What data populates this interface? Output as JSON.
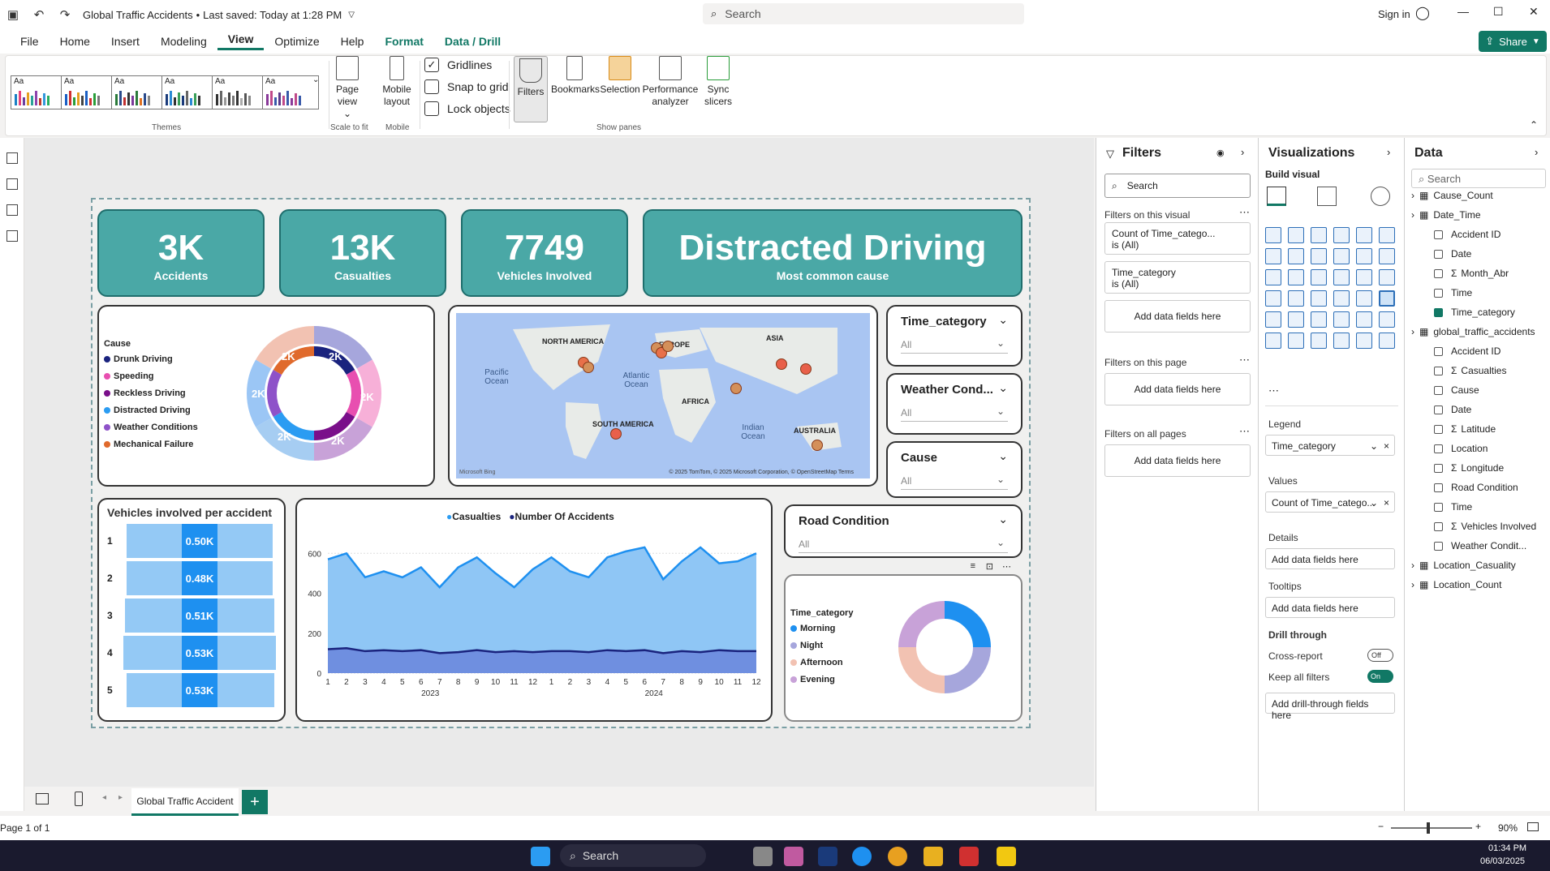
{
  "titlebar": {
    "title": "Global Traffic Accidents",
    "saved": "Last saved: Today at 1:28 PM",
    "search_placeholder": "Search",
    "signin": "Sign in"
  },
  "menu": [
    "File",
    "Home",
    "Insert",
    "Modeling",
    "View",
    "Optimize",
    "Help",
    "Format",
    "Data / Drill"
  ],
  "share": "Share",
  "ribbon": {
    "themes_label": "Themes",
    "page_view": "Page view",
    "scale_to_fit": "Scale to fit",
    "mobile_layout": "Mobile layout",
    "mobile": "Mobile",
    "gridlines": "Gridlines",
    "snap": "Snap to grid",
    "lock": "Lock objects",
    "filters": "Filters",
    "bookmarks": "Bookmarks",
    "selection": "Selection",
    "perf": "Performance analyzer",
    "sync": "Sync slicers",
    "show_panes": "Show panes"
  },
  "kpis": [
    {
      "value": "3K",
      "label": "Accidents"
    },
    {
      "value": "13K",
      "label": "Casualties"
    },
    {
      "value": "7749",
      "label": "Vehicles Involved"
    },
    {
      "value": "Distracted Driving",
      "label": "Most common cause"
    }
  ],
  "cause_donut": {
    "legend_title": "Cause",
    "items": [
      {
        "name": "Drunk Driving",
        "color": "#1a237e"
      },
      {
        "name": "Speeding",
        "color": "#e84fb0"
      },
      {
        "name": "Reckless Driving",
        "color": "#7a0f8a"
      },
      {
        "name": "Distracted Driving",
        "color": "#2b9cf2"
      },
      {
        "name": "Weather Conditions",
        "color": "#8e52c9"
      },
      {
        "name": "Mechanical Failure",
        "color": "#e06a2c"
      }
    ],
    "label": "2K"
  },
  "map": {
    "labels": [
      "NORTH AMERICA",
      "EUROPE",
      "ASIA",
      "AFRICA",
      "SOUTH AMERICA",
      "AUSTRALIA",
      "Pacific Ocean",
      "Atlantic Ocean",
      "Indian Ocean"
    ],
    "credit": "© 2025 TomTom, © 2025 Microsoft Corporation, © OpenStreetMap  Terms",
    "brand": "Microsoft Bing"
  },
  "slicers": [
    {
      "title": "Time_category",
      "value": "All"
    },
    {
      "title": "Weather Cond...",
      "value": "All"
    },
    {
      "title": "Cause",
      "value": "All"
    },
    {
      "title": "Road Condition",
      "value": "All"
    }
  ],
  "vehicles": {
    "title": "Vehicles involved per accident",
    "rows": [
      {
        "label": "1",
        "value": "0.50K"
      },
      {
        "label": "2",
        "value": "0.48K"
      },
      {
        "label": "3",
        "value": "0.51K"
      },
      {
        "label": "4",
        "value": "0.53K"
      },
      {
        "label": "5",
        "value": "0.53K"
      }
    ]
  },
  "chart_data": {
    "type": "area",
    "series": [
      {
        "name": "Casualties",
        "values": [
          570,
          600,
          480,
          510,
          480,
          530,
          430,
          530,
          580,
          500,
          430,
          520,
          580,
          510,
          480,
          580,
          610,
          630,
          470,
          560,
          630,
          550,
          560,
          600
        ]
      },
      {
        "name": "Number Of Accidents",
        "values": [
          120,
          125,
          110,
          115,
          110,
          115,
          100,
          105,
          115,
          105,
          110,
          105,
          110,
          110,
          105,
          115,
          110,
          115,
          100,
          110,
          105,
          115,
          110,
          110
        ]
      }
    ],
    "x": [
      "1",
      "2",
      "3",
      "4",
      "5",
      "6",
      "7",
      "8",
      "9",
      "10",
      "11",
      "12",
      "1",
      "2",
      "3",
      "4",
      "5",
      "6",
      "7",
      "8",
      "9",
      "10",
      "11",
      "12"
    ],
    "x_groups": [
      "2023",
      "2024"
    ],
    "yticks": [
      "0",
      "200",
      "400",
      "600"
    ],
    "ylim": [
      0,
      650
    ]
  },
  "time_donut": {
    "legend_title": "Time_category",
    "items": [
      {
        "name": "Morning",
        "color": "#1e90f0",
        "share": 25
      },
      {
        "name": "Night",
        "color": "#a6a6dc",
        "share": 25
      },
      {
        "name": "Afternoon",
        "color": "#f2c2b2",
        "share": 25
      },
      {
        "name": "Evening",
        "color": "#c8a2d8",
        "share": 25
      }
    ]
  },
  "filters_pane": {
    "title": "Filters",
    "search": "Search",
    "on_visual": "Filters on this visual",
    "f1": "Count of Time_catego...",
    "f1v": "is (All)",
    "f2": "Time_category",
    "f2v": "is (All)",
    "add": "Add data fields here",
    "on_page": "Filters on this page",
    "on_all": "Filters on all pages"
  },
  "viz_pane": {
    "title": "Visualizations",
    "build": "Build visual",
    "legend": "Legend",
    "legend_val": "Time_category",
    "values": "Values",
    "values_val": "Count of Time_catego...",
    "details": "Details",
    "tooltips": "Tooltips",
    "add": "Add data fields here",
    "drill": "Drill through",
    "cross": "Cross-report",
    "cross_state": "Off",
    "keep": "Keep all filters",
    "keep_state": "On",
    "add_drill": "Add drill-through fields here"
  },
  "data_pane": {
    "title": "Data",
    "search": "Search",
    "items": [
      {
        "label": "Cause_Count",
        "level": 0,
        "kind": "table"
      },
      {
        "label": "Date_Time",
        "level": 0,
        "kind": "table"
      },
      {
        "label": "Accident ID",
        "level": 1,
        "kind": "field"
      },
      {
        "label": "Date",
        "level": 1,
        "kind": "field"
      },
      {
        "label": "Month_Abr",
        "level": 1,
        "kind": "sum"
      },
      {
        "label": "Time",
        "level": 1,
        "kind": "field"
      },
      {
        "label": "Time_category",
        "level": 1,
        "kind": "checked"
      },
      {
        "label": "global_traffic_accidents",
        "level": 0,
        "kind": "table"
      },
      {
        "label": "Accident ID",
        "level": 1,
        "kind": "field"
      },
      {
        "label": "Casualties",
        "level": 1,
        "kind": "sum"
      },
      {
        "label": "Cause",
        "level": 1,
        "kind": "field"
      },
      {
        "label": "Date",
        "level": 1,
        "kind": "field"
      },
      {
        "label": "Latitude",
        "level": 1,
        "kind": "sum"
      },
      {
        "label": "Location",
        "level": 1,
        "kind": "field"
      },
      {
        "label": "Longitude",
        "level": 1,
        "kind": "sum"
      },
      {
        "label": "Road Condition",
        "level": 1,
        "kind": "field"
      },
      {
        "label": "Time",
        "level": 1,
        "kind": "field"
      },
      {
        "label": "Vehicles Involved",
        "level": 1,
        "kind": "sum"
      },
      {
        "label": "Weather Condit...",
        "level": 1,
        "kind": "field"
      },
      {
        "label": "Location_Casuality",
        "level": 0,
        "kind": "table"
      },
      {
        "label": "Location_Count",
        "level": 0,
        "kind": "table"
      }
    ]
  },
  "pagetab": "Global Traffic Accident",
  "status": {
    "page": "Page 1 of 1",
    "zoom": "90%"
  },
  "taskbar": {
    "search": "Search",
    "time": "01:34 PM",
    "date": "06/03/2025"
  }
}
